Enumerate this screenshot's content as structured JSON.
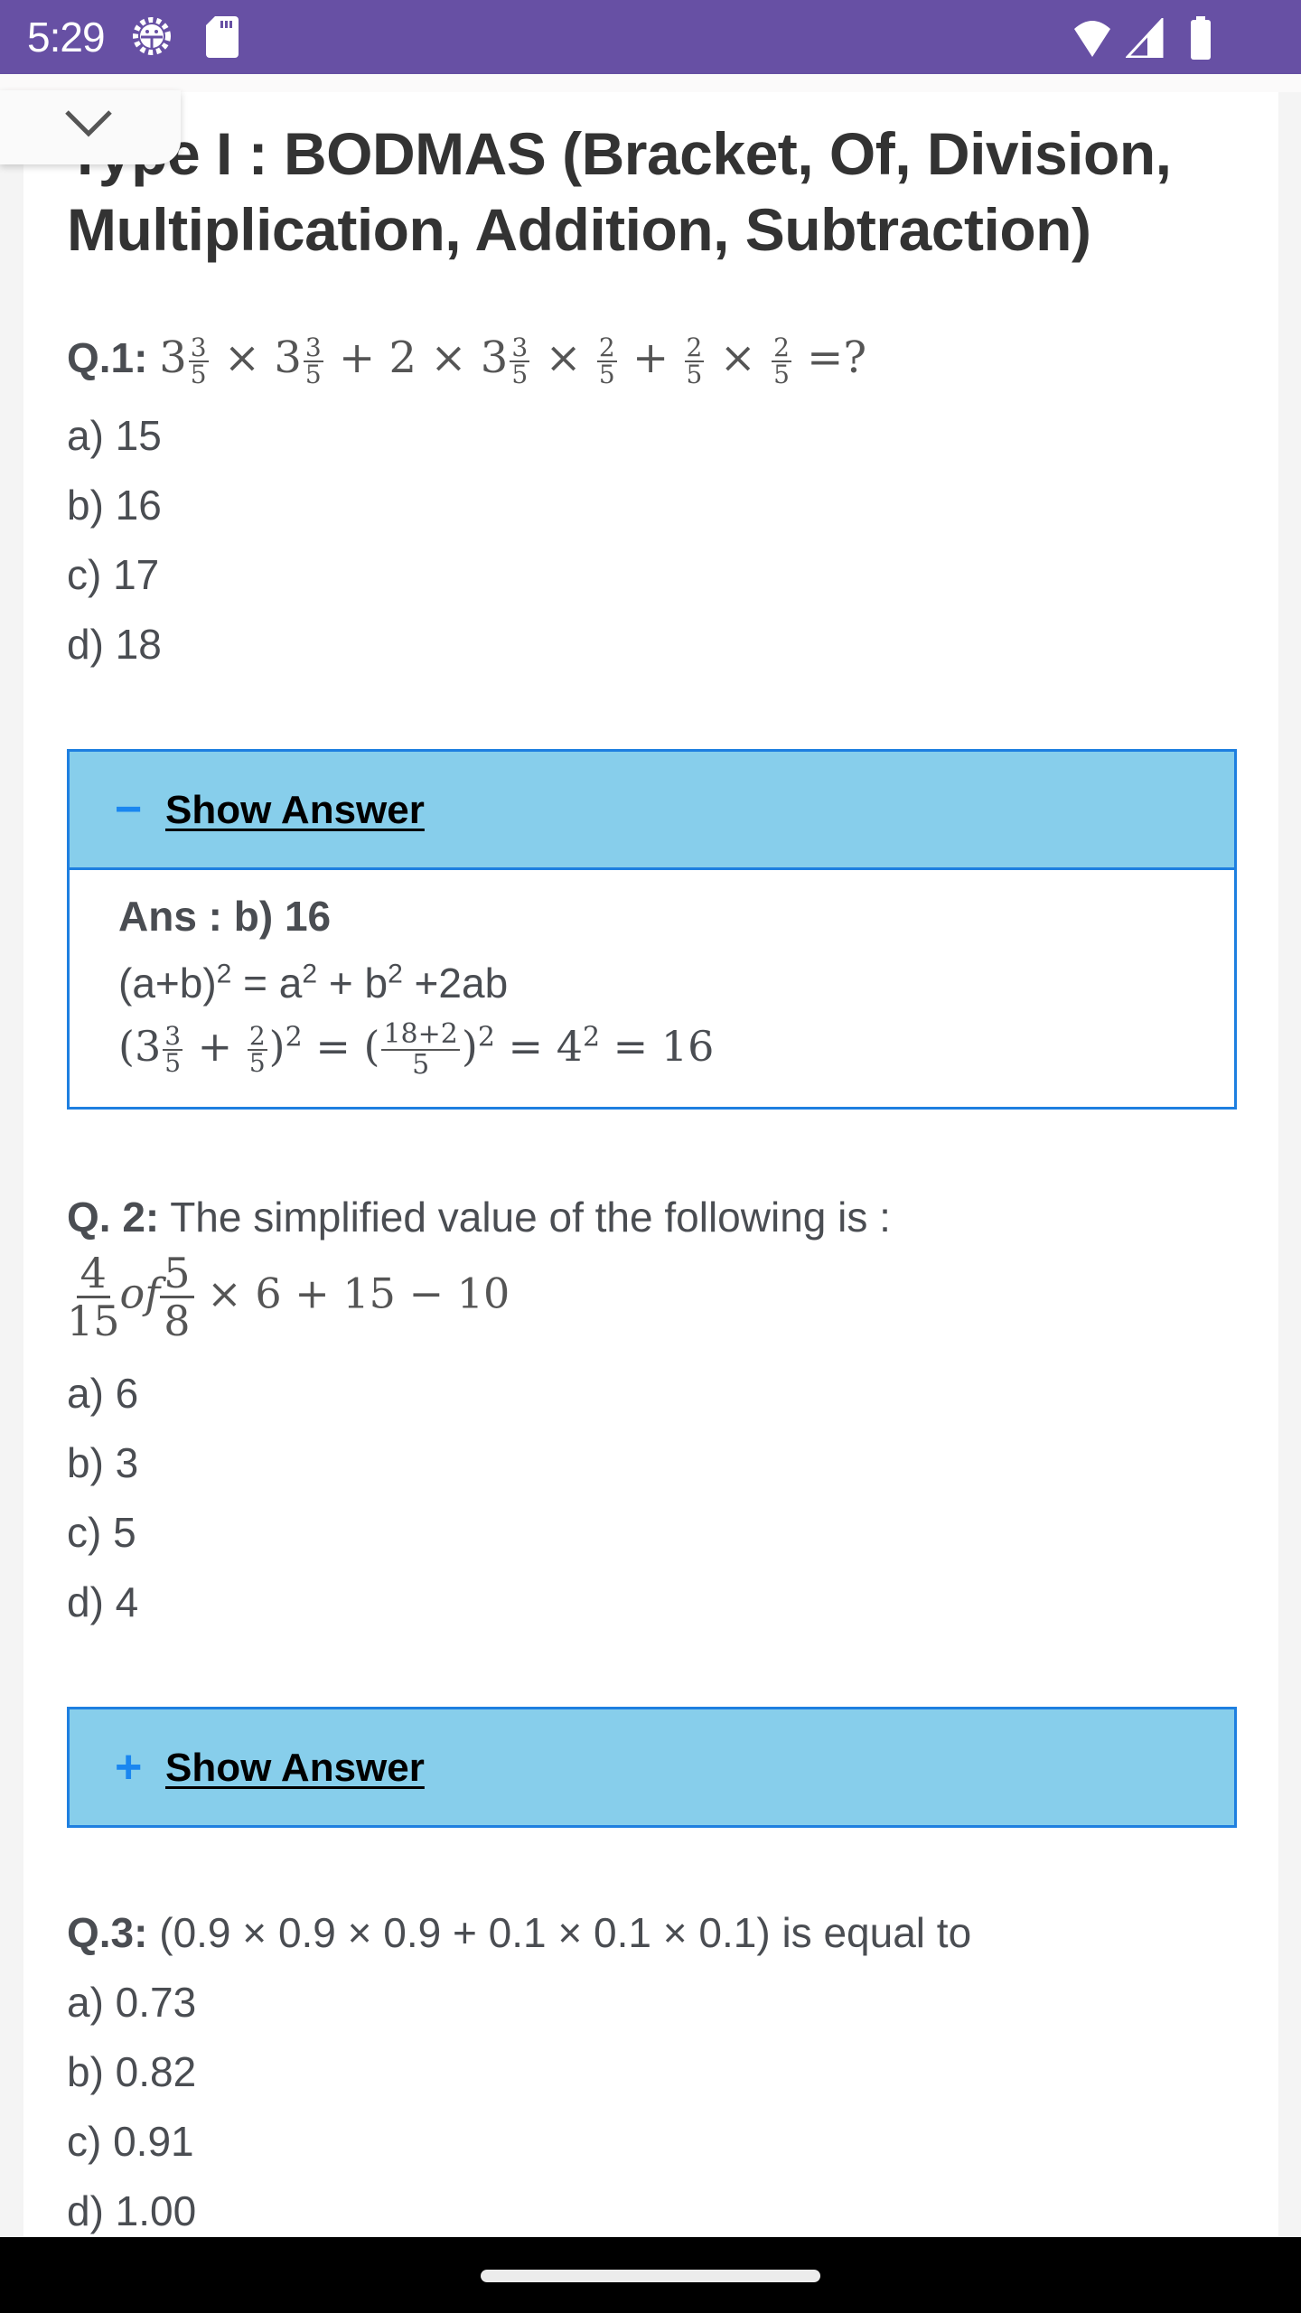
{
  "status_bar": {
    "time": "5:29",
    "left_icons": [
      "debug-settings-icon",
      "sd-card-icon"
    ],
    "right_icons": [
      "wifi-icon",
      "signal-icon",
      "battery-icon"
    ],
    "color": "#6750a4"
  },
  "page": {
    "title": "Type I : BODMAS (Bracket, Of, Division, Multiplication, Addition, Subtraction)",
    "collapse_icon": "chevron-down-icon"
  },
  "questions": [
    {
      "label": "Q.1:",
      "expression": "3 3/5 × 3 3/5 + 2 × 3 3/5 × 2/5 + 2/5 × 2/5 = ?",
      "options": [
        "a) 15",
        "b) 16",
        "c) 17",
        "d) 18"
      ],
      "answer_toggle": {
        "sign": "−",
        "label": "Show Answer",
        "expanded": true
      },
      "answer": {
        "ans": "Ans : b) 16",
        "formula": "(a+b)² = a² + b² +2ab",
        "working": "(3 3/5 + 2/5)² = ((18+2)/5)² = 4² = 16"
      }
    },
    {
      "label": "Q. 2:",
      "text": "The simplified value of the following is :",
      "expression": "4/15 of 5/8 × 6 + 15 − 10",
      "options": [
        "a) 6",
        "b) 3",
        "c) 5",
        "d) 4"
      ],
      "answer_toggle": {
        "sign": "+",
        "label": "Show Answer",
        "expanded": false
      }
    },
    {
      "label": "Q.3:",
      "text": "(0.9 × 0.9 × 0.9 + 0.1 × 0.1 × 0.1) is equal to",
      "options": [
        "a) 0.73",
        "b) 0.82",
        "c) 0.91",
        "d) 1.00"
      ]
    }
  ],
  "m": {
    "q1": {
      "w1": "3",
      "n1": "3",
      "d1": "5",
      "x": "×",
      "plus": "+",
      "two": "2",
      "eq": "=?"
    },
    "ans": {
      "sup2": "2",
      "a": "(a+b)",
      "eqa": " = a",
      "pb": " + b",
      "tab": " +2ab"
    },
    "work": {
      "open": "(3",
      "plus": " + ",
      "close": ")",
      "eq": " = (",
      "n": "18+2",
      "d": "5",
      "close2": ")",
      "eq4": " = 4",
      "eq16": " = 16"
    },
    "q2": {
      "n1": "4",
      "d1": "15",
      "of": "of",
      "n2": "5",
      "d2": "8",
      "rest": " × 6 + 15 − 10"
    }
  }
}
